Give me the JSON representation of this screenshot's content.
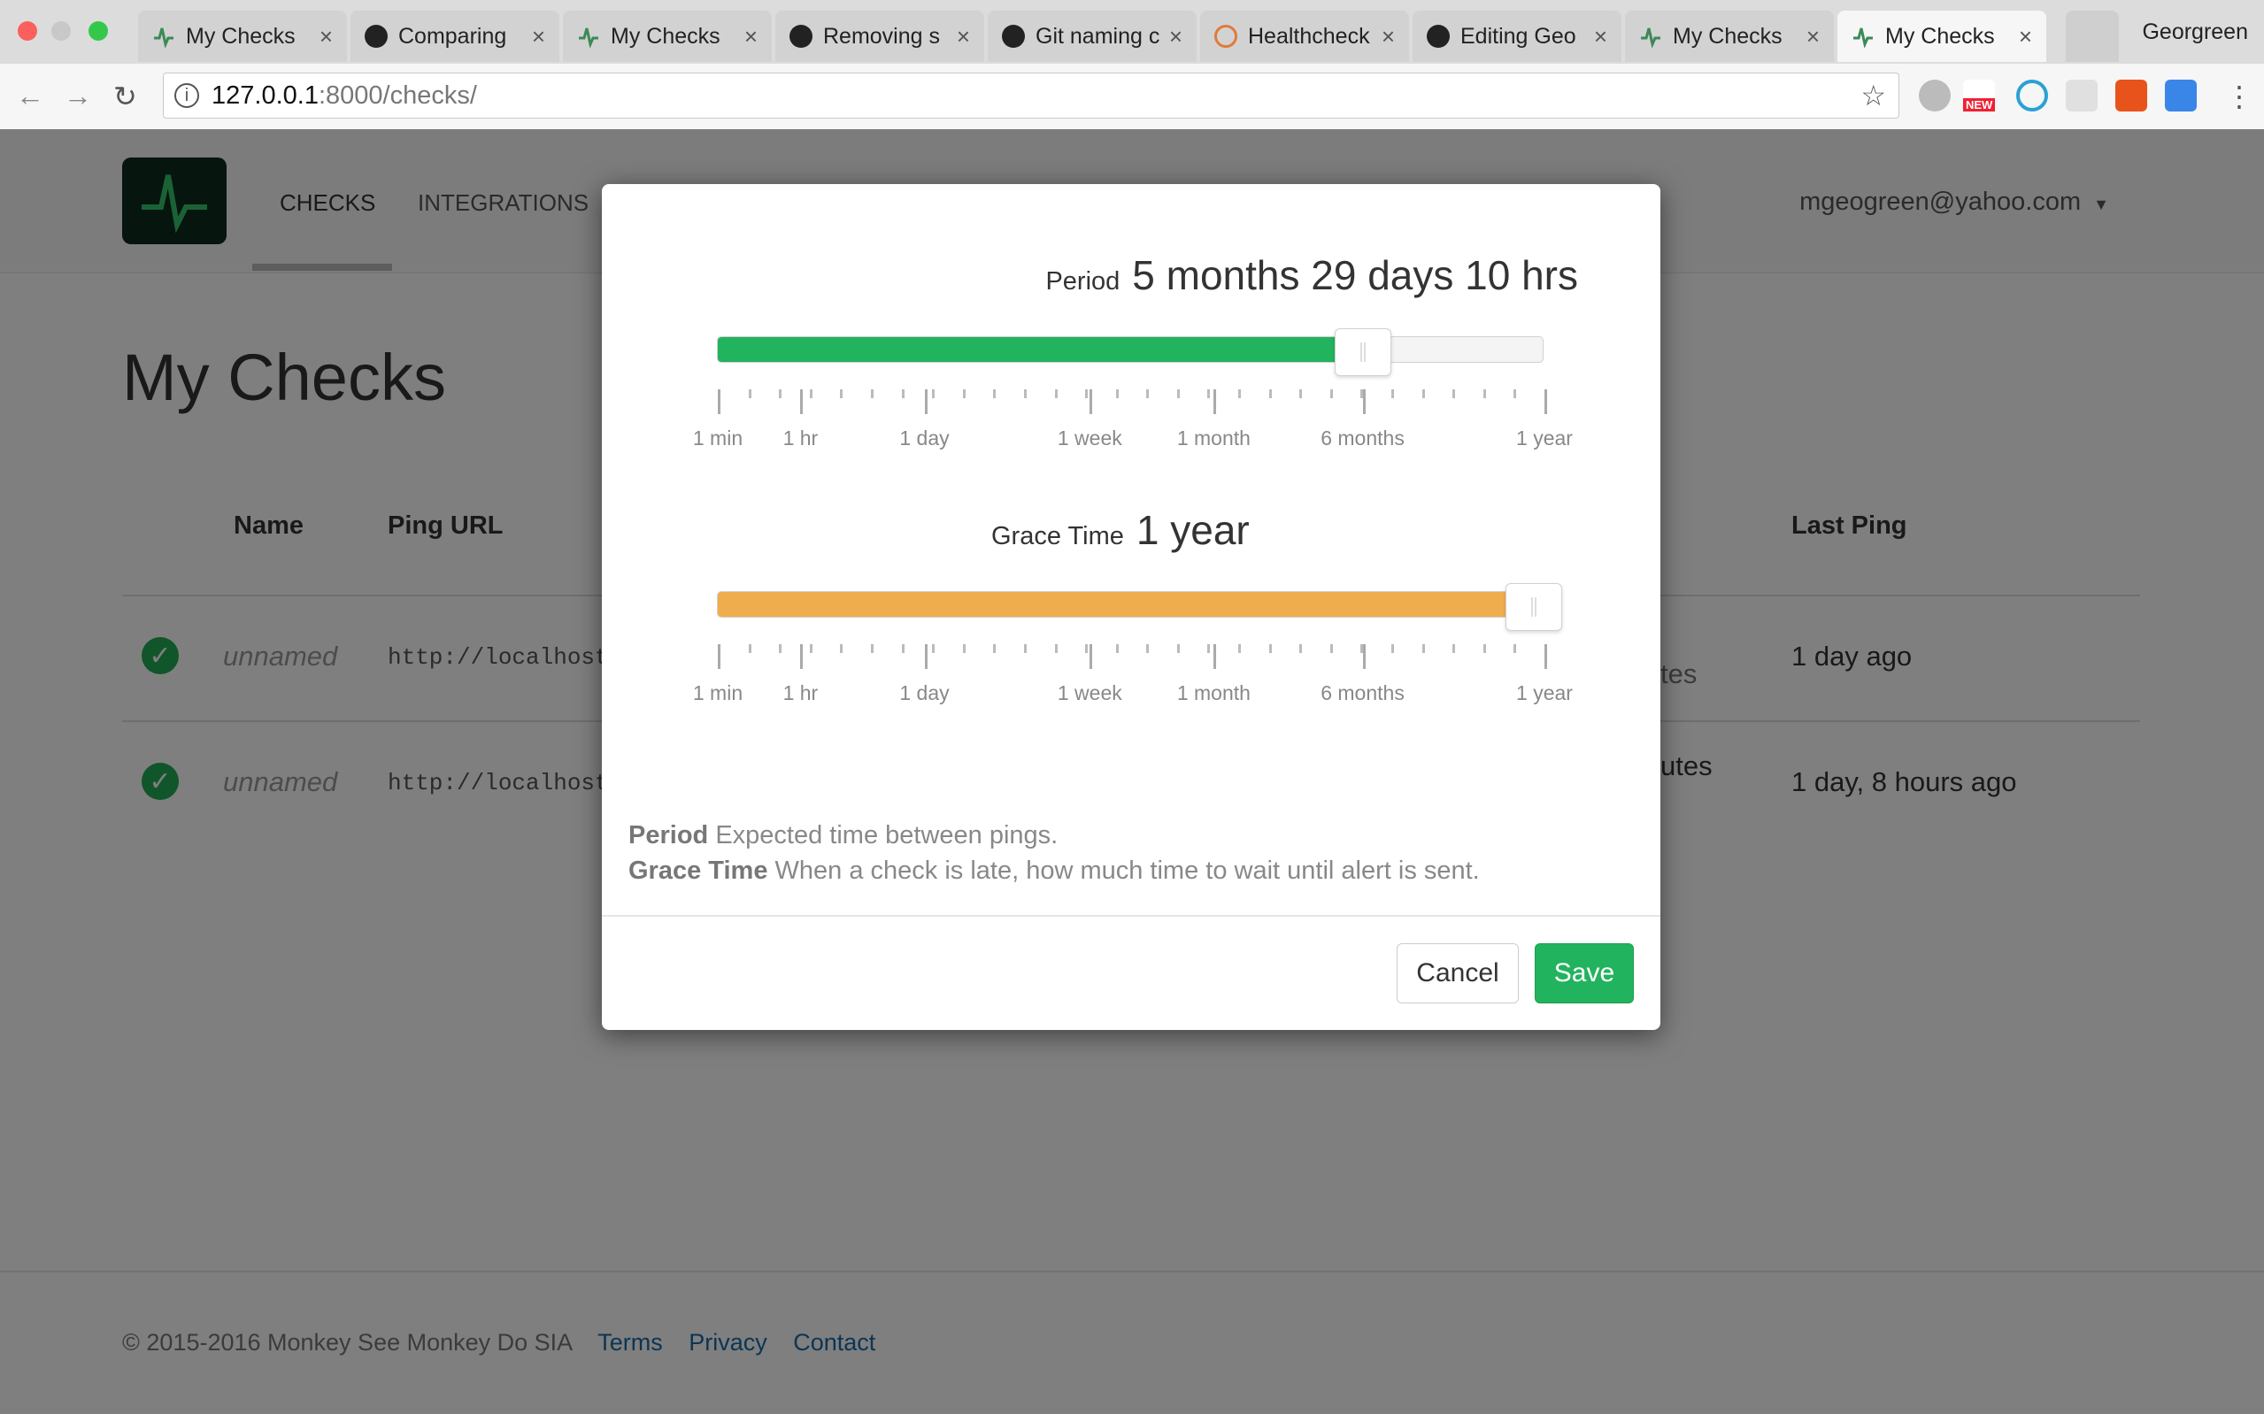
{
  "browser": {
    "tabs": [
      {
        "label": "My Checks",
        "favicon": "healthchecks-icon"
      },
      {
        "label": "Comparing",
        "favicon": "github-icon"
      },
      {
        "label": "My Checks",
        "favicon": "healthchecks-icon"
      },
      {
        "label": "Removing s",
        "favicon": "github-icon"
      },
      {
        "label": "Git naming c",
        "favicon": "github-icon"
      },
      {
        "label": "Healthcheck",
        "favicon": "orange-gear-icon"
      },
      {
        "label": "Editing Geo",
        "favicon": "github-icon"
      },
      {
        "label": "My Checks",
        "favicon": "healthchecks-icon"
      },
      {
        "label": "My Checks",
        "favicon": "healthchecks-icon",
        "active": true
      }
    ],
    "tab_close": "×",
    "profile": "Georgreen",
    "url_host": "127.0.0.1",
    "url_path": ":8000/checks/",
    "ext_new_badge": "NEW"
  },
  "nav": {
    "checks": "CHECKS",
    "integrations": "INTEGRATIONS",
    "user": "mgeogreen@yahoo.com"
  },
  "page": {
    "title": "My Checks",
    "headers": {
      "name": "Name",
      "ping_url": "Ping URL",
      "last_ping": "Last Ping"
    },
    "rows": [
      {
        "name": "unnamed",
        "url": "http://localhost:",
        "period_partial": "tes",
        "last_ping": "1 day ago"
      },
      {
        "name": "unnamed",
        "url": "http://localhost:",
        "period_partial": "utes",
        "last_ping": "1 day, 8 hours ago"
      }
    ]
  },
  "footer": {
    "copyright": "© 2015-2016 Monkey See Monkey Do SIA",
    "terms": "Terms",
    "privacy": "Privacy",
    "contact": "Contact"
  },
  "modal": {
    "period": {
      "label": "Period",
      "value": "5 months 29 days 10 hrs",
      "fraction": 0.78,
      "color": "#22b35e"
    },
    "grace": {
      "label": "Grace Time",
      "value": "1 year",
      "fraction": 1.0,
      "color": "#f0ad4e"
    },
    "scale_labels": [
      "1 min",
      "1 hr",
      "1 day",
      "1 week",
      "1 month",
      "6 months",
      "1 year"
    ],
    "help_period_term": "Period",
    "help_period_text": "Expected time between pings.",
    "help_grace_term": "Grace Time",
    "help_grace_text": "When a check is late, how much time to wait until alert is sent.",
    "cancel": "Cancel",
    "save": "Save"
  }
}
